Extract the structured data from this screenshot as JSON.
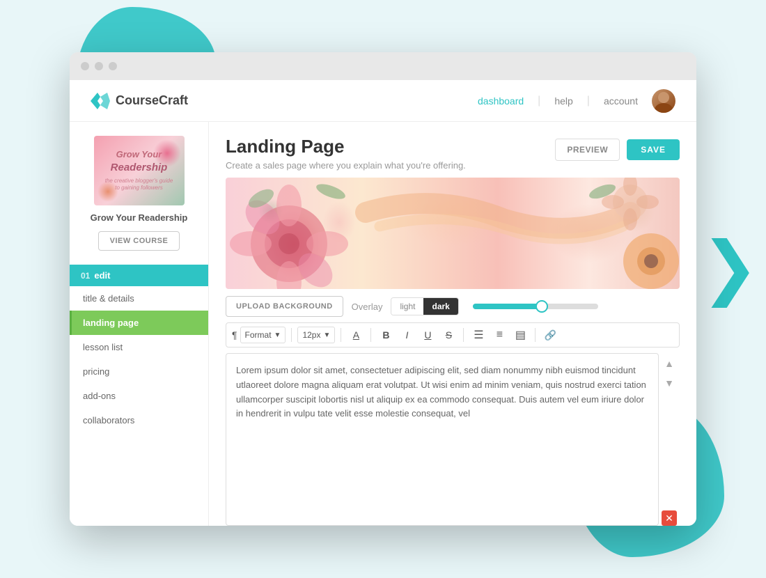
{
  "device": {
    "dots": [
      "red-dot",
      "yellow-dot",
      "green-dot"
    ]
  },
  "nav": {
    "logo_text": "CourseCraft",
    "links": [
      {
        "label": "dashboard",
        "active": true
      },
      {
        "label": "help",
        "active": false
      },
      {
        "label": "account",
        "active": false
      }
    ]
  },
  "sidebar": {
    "course_name": "Grow Your Readership",
    "view_course_label": "VIEW COURSE",
    "section_number": "01",
    "section_label": "edit",
    "items": [
      {
        "label": "title & details",
        "active": false
      },
      {
        "label": "landing page",
        "active": true
      },
      {
        "label": "lesson list",
        "active": false
      },
      {
        "label": "pricing",
        "active": false
      },
      {
        "label": "add-ons",
        "active": false
      },
      {
        "label": "collaborators",
        "active": false
      }
    ]
  },
  "page": {
    "title": "Landing Page",
    "subtitle": "Create a sales page where you explain what you're offering.",
    "preview_label": "PREVIEW",
    "save_label": "SAVE"
  },
  "toolbar": {
    "upload_bg_label": "UPLOAD BACKGROUND",
    "overlay_label": "Overlay",
    "toggle_light": "light",
    "toggle_dark": "dark",
    "format_label": "Format",
    "font_size": "12px",
    "buttons": [
      {
        "label": "A",
        "title": "font-color"
      },
      {
        "label": "B",
        "title": "bold"
      },
      {
        "label": "I",
        "title": "italic"
      },
      {
        "label": "U",
        "title": "underline"
      },
      {
        "label": "S",
        "title": "strikethrough"
      },
      {
        "label": "☰",
        "title": "ordered-list"
      },
      {
        "label": "≡",
        "title": "unordered-list"
      },
      {
        "label": "≡",
        "title": "align"
      },
      {
        "label": "🔗",
        "title": "link"
      }
    ]
  },
  "editor": {
    "body_text": "Lorem ipsum dolor sit amet, consectetuer adipiscing elit, sed diam nonummy nibh euismod tincidunt utlaoreet dolore magna aliquam erat volutpat. Ut wisi enim ad minim veniam, quis nostrud exerci tation ullamcorper suscipit lobortis nisl ut aliquip ex ea commodo consequat. Duis autem vel eum iriure dolor in hendrerit in vulpu tate velit esse molestie consequat, vel"
  },
  "colors": {
    "teal": "#2ec4c4",
    "green": "#7dca5a",
    "save_bg": "#2ec4c4",
    "active_nav": "#2ec4c4"
  }
}
